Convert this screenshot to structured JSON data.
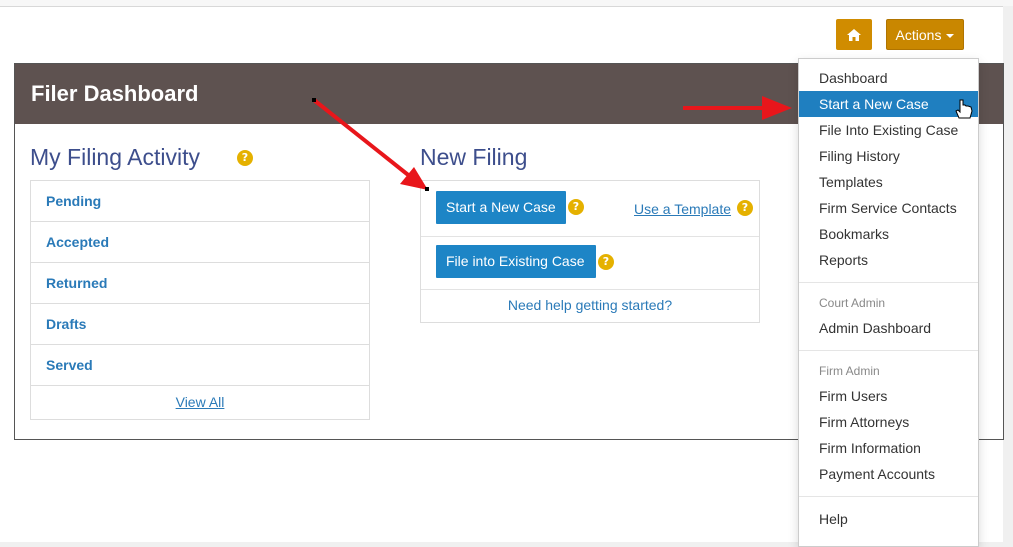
{
  "header": {
    "actions_label": "Actions"
  },
  "dashboard": {
    "title": "Filer Dashboard",
    "activity": {
      "title": "My Filing Activity",
      "help": "?",
      "items": [
        "Pending",
        "Accepted",
        "Returned",
        "Drafts",
        "Served"
      ],
      "view_all": "View All"
    },
    "new_filing": {
      "title": "New Filing",
      "start_new_case": "Start a New Case",
      "use_template": "Use a Template",
      "file_into_existing": "File into Existing Case",
      "help_link": "Need help getting started?",
      "help": "?"
    }
  },
  "menu": {
    "items": [
      "Dashboard",
      "Start a New Case",
      "File Into Existing Case",
      "Filing History",
      "Templates",
      "Firm Service Contacts",
      "Bookmarks",
      "Reports"
    ],
    "court_admin_header": "Court Admin",
    "court_admin_items": [
      "Admin Dashboard"
    ],
    "firm_admin_header": "Firm Admin",
    "firm_admin_items": [
      "Firm Users",
      "Firm Attorneys",
      "Firm Information",
      "Payment Accounts"
    ],
    "help": "Help"
  },
  "colors": {
    "accent": "#c98700",
    "header_bg": "#5e5250",
    "primary": "#1d85c6",
    "annotation_arrow": "#e8161b"
  },
  "icons": {
    "home": "home-icon",
    "pointer": "hand-pointer-icon"
  }
}
